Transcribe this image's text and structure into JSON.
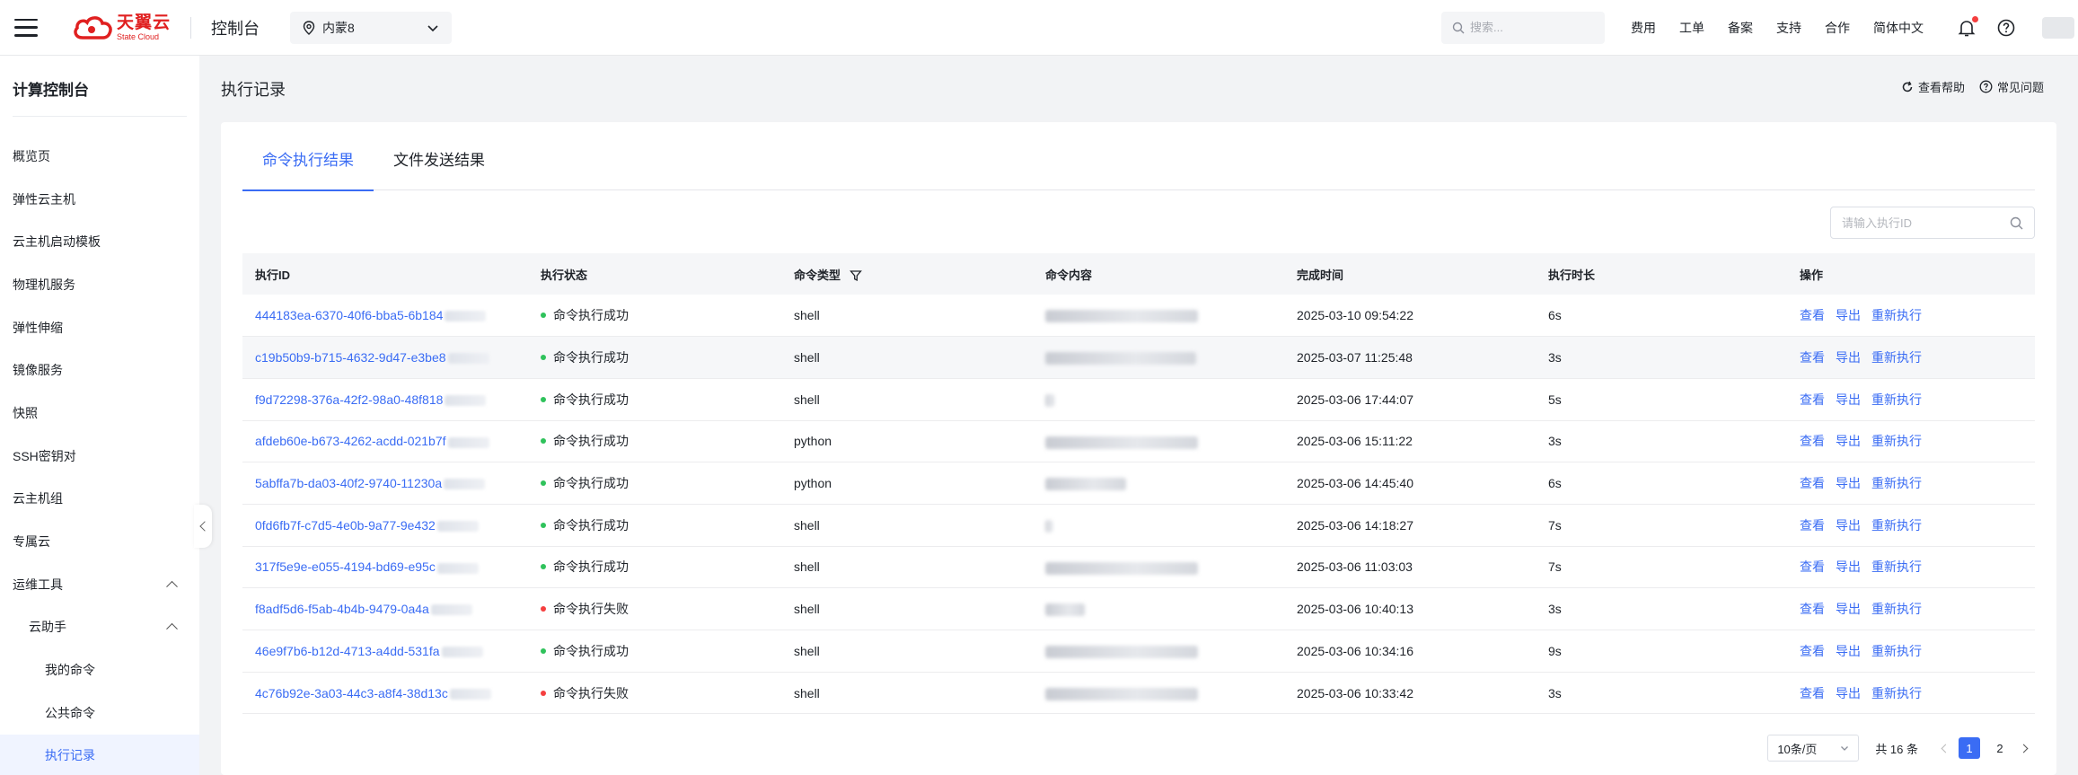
{
  "topbar": {
    "logo_cn": "天翼云",
    "logo_en": "State Cloud",
    "console_title": "控制台",
    "region": "内蒙8",
    "search_placeholder": "搜索...",
    "nav": [
      "费用",
      "工单",
      "备案",
      "支持",
      "合作",
      "简体中文"
    ]
  },
  "sidebar": {
    "title": "计算控制台",
    "items": [
      {
        "label": "概览页"
      },
      {
        "label": "弹性云主机"
      },
      {
        "label": "云主机启动模板"
      },
      {
        "label": "物理机服务"
      },
      {
        "label": "弹性伸缩"
      },
      {
        "label": "镜像服务"
      },
      {
        "label": "快照"
      },
      {
        "label": "SSH密钥对"
      },
      {
        "label": "云主机组"
      },
      {
        "label": "专属云"
      },
      {
        "label": "运维工具"
      },
      {
        "label": "云助手"
      },
      {
        "label": "我的命令"
      },
      {
        "label": "公共命令"
      },
      {
        "label": "执行记录"
      }
    ]
  },
  "page": {
    "title": "执行记录",
    "help": "查看帮助",
    "faq": "常见问题"
  },
  "tabs": [
    "命令执行结果",
    "文件发送结果"
  ],
  "id_search_placeholder": "请输入执行ID",
  "table": {
    "columns": [
      "执行ID",
      "执行状态",
      "命令类型",
      "命令内容",
      "完成时间",
      "执行时长",
      "操作"
    ],
    "actions": [
      "查看",
      "导出",
      "重新执行"
    ],
    "rows": [
      {
        "id": "444183ea-6370-40f6-bba5-6b184",
        "status": "命令执行成功",
        "ok": true,
        "type": "shell",
        "time": "2025-03-10 09:54:22",
        "duration": "6s"
      },
      {
        "id": "c19b50b9-b715-4632-9d47-e3be8",
        "status": "命令执行成功",
        "ok": true,
        "type": "shell",
        "time": "2025-03-07 11:25:48",
        "duration": "3s"
      },
      {
        "id": "f9d72298-376a-42f2-98a0-48f818",
        "status": "命令执行成功",
        "ok": true,
        "type": "shell",
        "time": "2025-03-06 17:44:07",
        "duration": "5s"
      },
      {
        "id": "afdeb60e-b673-4262-acdd-021b7f",
        "status": "命令执行成功",
        "ok": true,
        "type": "python",
        "time": "2025-03-06 15:11:22",
        "duration": "3s"
      },
      {
        "id": "5abffa7b-da03-40f2-9740-11230a",
        "status": "命令执行成功",
        "ok": true,
        "type": "python",
        "time": "2025-03-06 14:45:40",
        "duration": "6s"
      },
      {
        "id": "0fd6fb7f-c7d5-4e0b-9a77-9e432",
        "status": "命令执行成功",
        "ok": true,
        "type": "shell",
        "time": "2025-03-06 14:18:27",
        "duration": "7s"
      },
      {
        "id": "317f5e9e-e055-4194-bd69-e95c",
        "status": "命令执行成功",
        "ok": true,
        "type": "shell",
        "time": "2025-03-06 11:03:03",
        "duration": "7s"
      },
      {
        "id": "f8adf5d6-f5ab-4b4b-9479-0a4a",
        "status": "命令执行失败",
        "ok": false,
        "type": "shell",
        "time": "2025-03-06 10:40:13",
        "duration": "3s"
      },
      {
        "id": "46e9f7b6-b12d-4713-a4dd-531fa",
        "status": "命令执行成功",
        "ok": true,
        "type": "shell",
        "time": "2025-03-06 10:34:16",
        "duration": "9s"
      },
      {
        "id": "4c76b92e-3a03-44c3-a8f4-38d13c",
        "status": "命令执行失败",
        "ok": false,
        "type": "shell",
        "time": "2025-03-06 10:33:42",
        "duration": "3s"
      }
    ]
  },
  "pagination": {
    "page_size": "10条/页",
    "total": "共 16 条",
    "pages": [
      "1",
      "2"
    ],
    "current": "1"
  },
  "colors": {
    "accent": "#3a6cf4",
    "success": "#2fc25b",
    "fail": "#f53f3f",
    "brand": "#e02020"
  }
}
